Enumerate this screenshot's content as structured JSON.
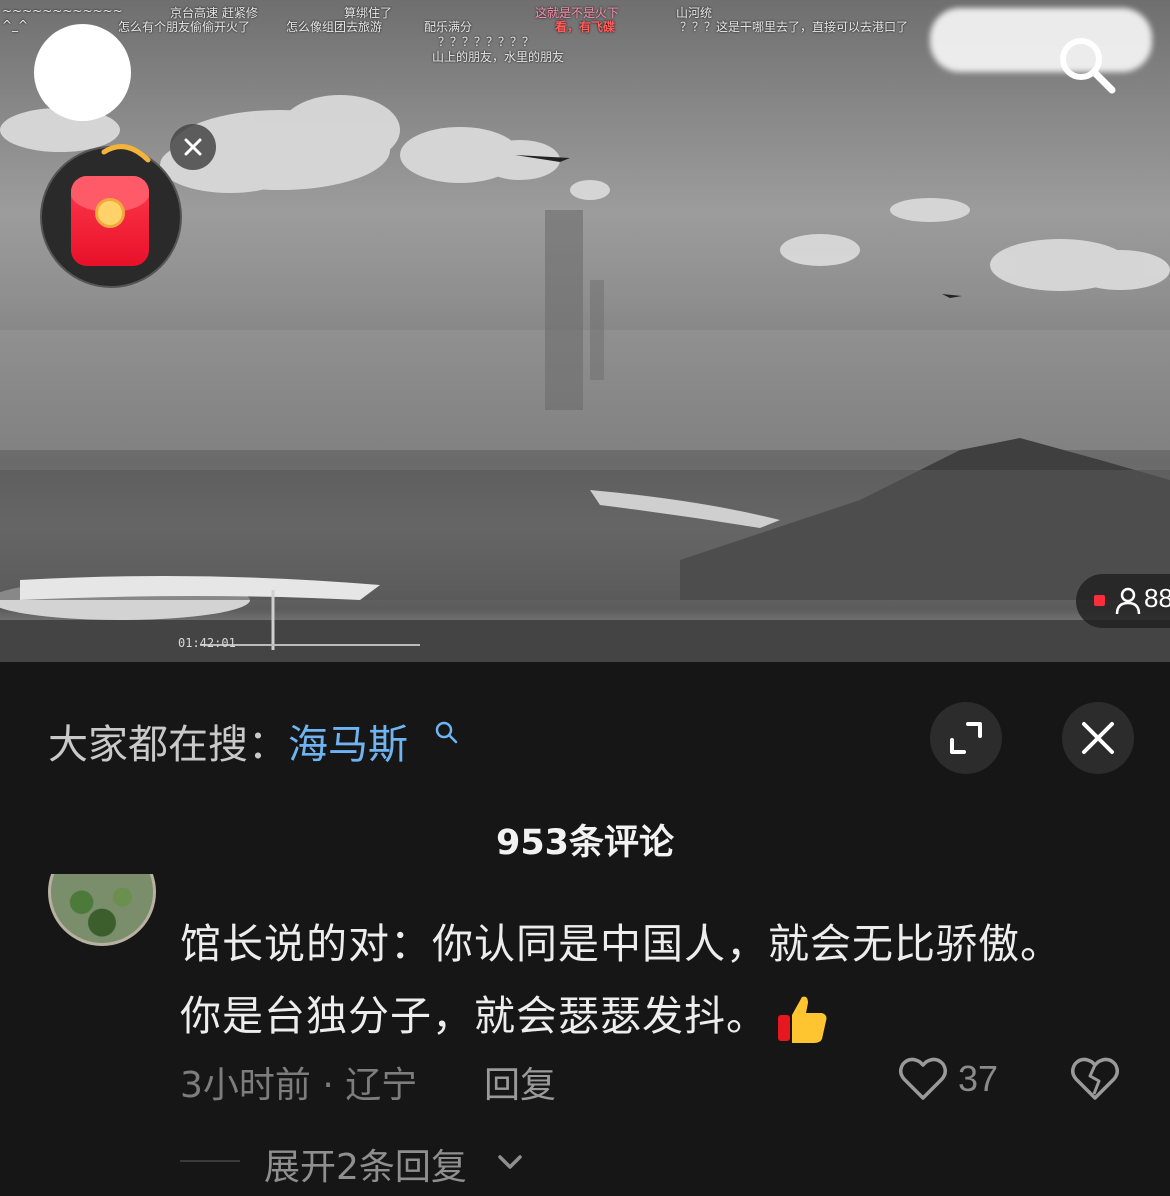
{
  "video": {
    "danmaku": [
      {
        "text": "~~~~~~~~~~~~",
        "style": "normal"
      },
      {
        "text": "^_^",
        "style": "normal"
      },
      {
        "text": "京台高速 赶紧修",
        "style": "normal"
      },
      {
        "text": "怎么有个朋友偷偷开火了",
        "style": "normal"
      },
      {
        "text": "算绑住了",
        "style": "normal"
      },
      {
        "text": "怎么像组团去旅游",
        "style": "normal"
      },
      {
        "text": "配乐满分",
        "style": "normal"
      },
      {
        "text": "？？？？？？？？",
        "style": "normal"
      },
      {
        "text": "山上的朋友，水里的朋友",
        "style": "normal"
      },
      {
        "text": "这就是不是火下",
        "style": "pink"
      },
      {
        "text": "看，有飞碟",
        "style": "red"
      },
      {
        "text": "山河统",
        "style": "normal"
      },
      {
        "text": "？？？这是干哪里去了，直接可以去港口了",
        "style": "normal"
      }
    ],
    "timestamp": "01:42:01",
    "live_viewers": "88",
    "colors": {
      "live_dot": "#ff2d3c"
    }
  },
  "panel": {
    "hot_search_label": "大家都在搜：",
    "hot_search_keyword": "海马斯",
    "comment_count_label": "953条评论",
    "icons": {
      "expand": "expand-icon",
      "close": "close-icon",
      "search": "search-icon"
    }
  },
  "comment": {
    "text_line1": "馆长说的对：你认同是中国人，就会无比骄傲。",
    "text_line2": "你是台独分子，就会瑟瑟发抖。",
    "emoji": "thumbs-up",
    "time_location": "3小时前 · 辽宁",
    "reply_label": "回复",
    "likes": "37",
    "expand_replies_label": "展开2条回复"
  },
  "colors": {
    "keyword": "#6fb4f2",
    "panel_bg": "#161616"
  }
}
